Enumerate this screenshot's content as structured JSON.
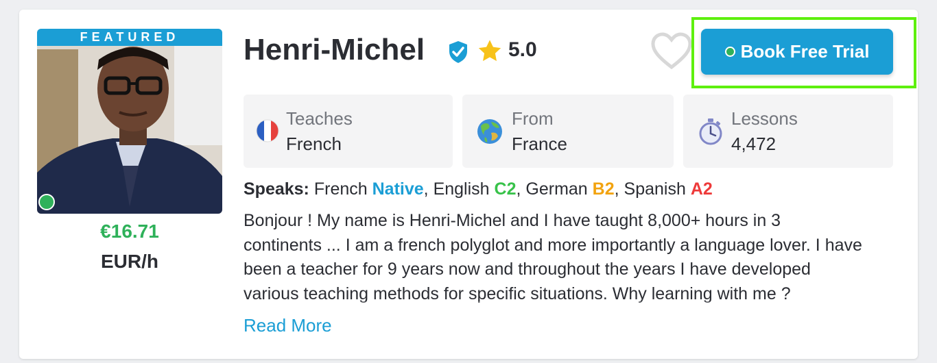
{
  "card": {
    "featured_label": "FEATURED",
    "tutor_name": "Henri-Michel",
    "rating": "5.0",
    "price": "€16.71",
    "price_unit": "EUR/h",
    "book_button_label": "Book Free Trial"
  },
  "info_boxes": [
    {
      "label": "Teaches",
      "value": "French",
      "icon": "france-flag-icon"
    },
    {
      "label": "From",
      "value": "France",
      "icon": "globe-icon"
    },
    {
      "label": "Lessons",
      "value": "4,472",
      "icon": "stopwatch-icon"
    }
  ],
  "speaks": {
    "label": "Speaks:",
    "languages": [
      {
        "name": "French",
        "level": "Native"
      },
      {
        "name": "English",
        "level": "C2"
      },
      {
        "name": "German",
        "level": "B2"
      },
      {
        "name": "Spanish",
        "level": "A2"
      }
    ]
  },
  "bio": {
    "lines": [
      "Bonjour ! My name is Henri-Michel and I have taught 8,000+ hours in 3",
      "continents ... I am a french polyglot and more importantly a language lover. I have",
      "been a teacher for 9 years now and throughout the years I have developed",
      "various teaching methods for specific situations. Why learning with me ?"
    ],
    "read_more": "Read More"
  },
  "colors": {
    "accent": "#1b9ed5",
    "online": "#2fb15a",
    "highlight": "#5ef00e",
    "level_native": "#1b9ed5",
    "level_c2": "#38c24a",
    "level_b2": "#f2a30f",
    "level_a2": "#ee3a3a"
  }
}
